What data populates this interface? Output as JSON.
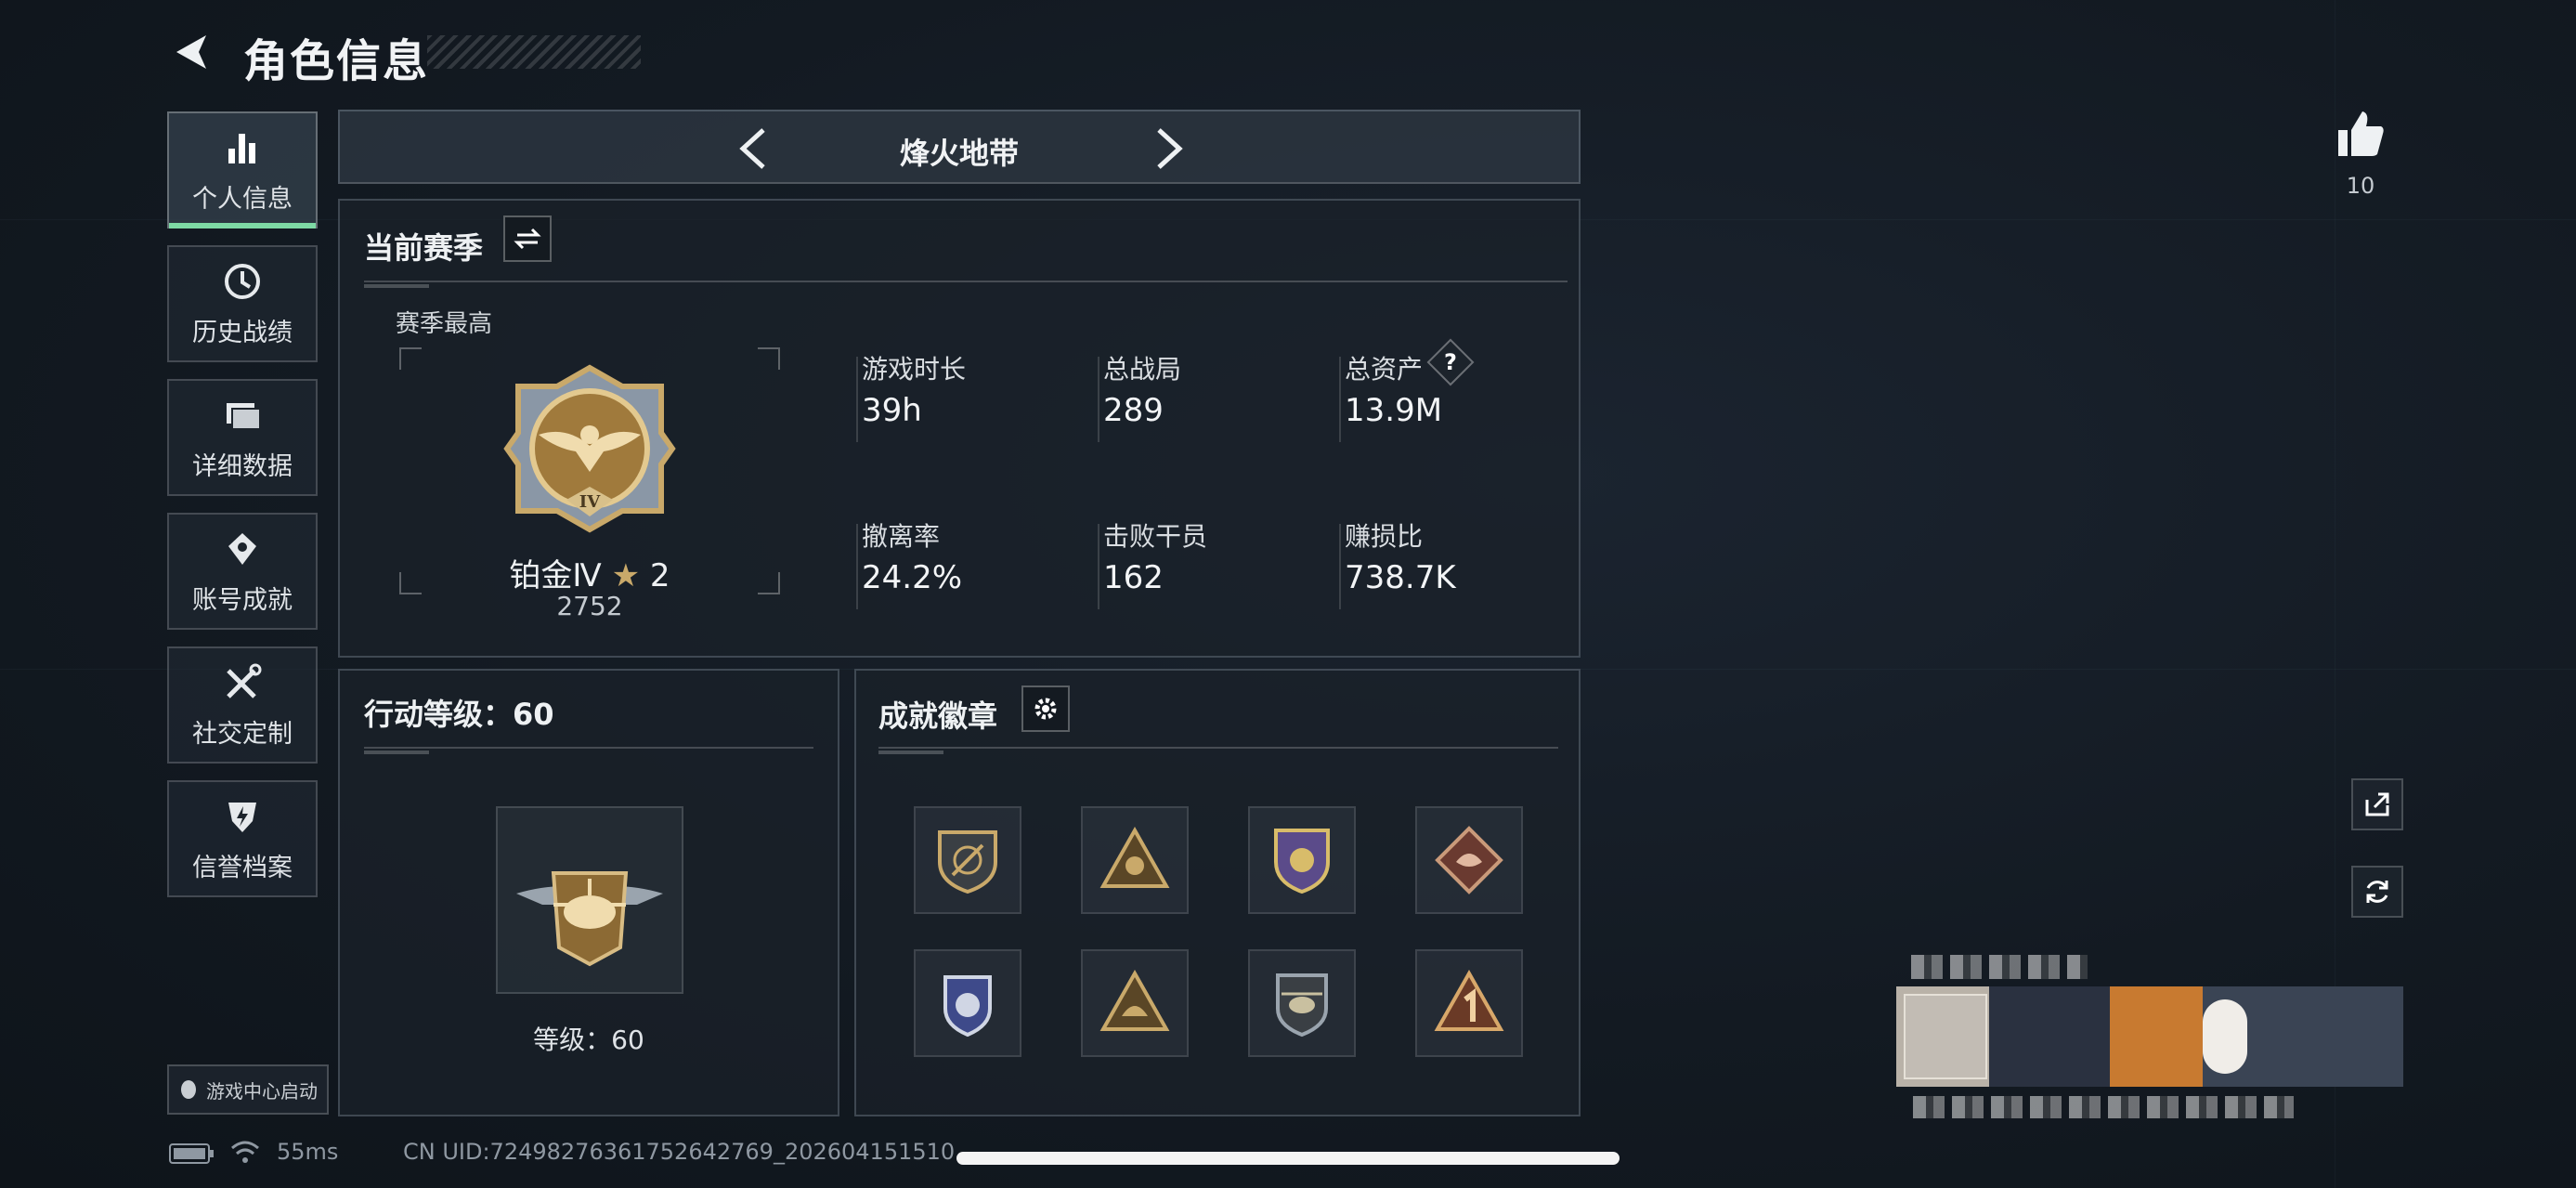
{
  "header": {
    "title": "角色信息"
  },
  "sidebar": {
    "items": [
      {
        "label": "个人信息",
        "icon": "bar-chart-icon",
        "active": true
      },
      {
        "label": "历史战绩",
        "icon": "clock-icon",
        "active": false
      },
      {
        "label": "详细数据",
        "icon": "folder-icon",
        "active": false
      },
      {
        "label": "账号成就",
        "icon": "achievement-icon",
        "active": false
      },
      {
        "label": "社交定制",
        "icon": "tools-icon",
        "active": false
      },
      {
        "label": "信誉档案",
        "icon": "shield-bolt-icon",
        "active": false
      }
    ],
    "game_center": "游戏中心启动"
  },
  "mode": {
    "name": "烽火地带"
  },
  "season": {
    "title": "当前赛季",
    "best_label": "赛季最高",
    "rank": {
      "name": "铂金Ⅳ",
      "stars": "2",
      "score": "2752",
      "emblem": "IV"
    },
    "stats": [
      {
        "label": "游戏时长",
        "value": "39h"
      },
      {
        "label": "总战局",
        "value": "289"
      },
      {
        "label": "总资产",
        "value": "13.9M",
        "help": "?"
      },
      {
        "label": "撤离率",
        "value": "24.2%"
      },
      {
        "label": "击败干员",
        "value": "162"
      },
      {
        "label": "赚损比",
        "value": "738.7K"
      }
    ]
  },
  "level": {
    "title": "行动等级：60",
    "caption": "等级：60"
  },
  "badges": {
    "title": "成就徽章",
    "items": [
      "rifle-shield-badge",
      "triangle-crest-badge",
      "purple-shield-badge",
      "dragon-diamond-badge",
      "police-badge",
      "helmet-triangle-badge",
      "helicopter-badge",
      "number-one-badge"
    ]
  },
  "likes": {
    "count": "10"
  },
  "status": {
    "ping": "55ms",
    "uid": "CN UID:7249827636175264276​9_20260415151​0"
  },
  "colors": {
    "accent": "#7dd9a4",
    "gold": "#c9a96a",
    "background": "#141b23"
  }
}
